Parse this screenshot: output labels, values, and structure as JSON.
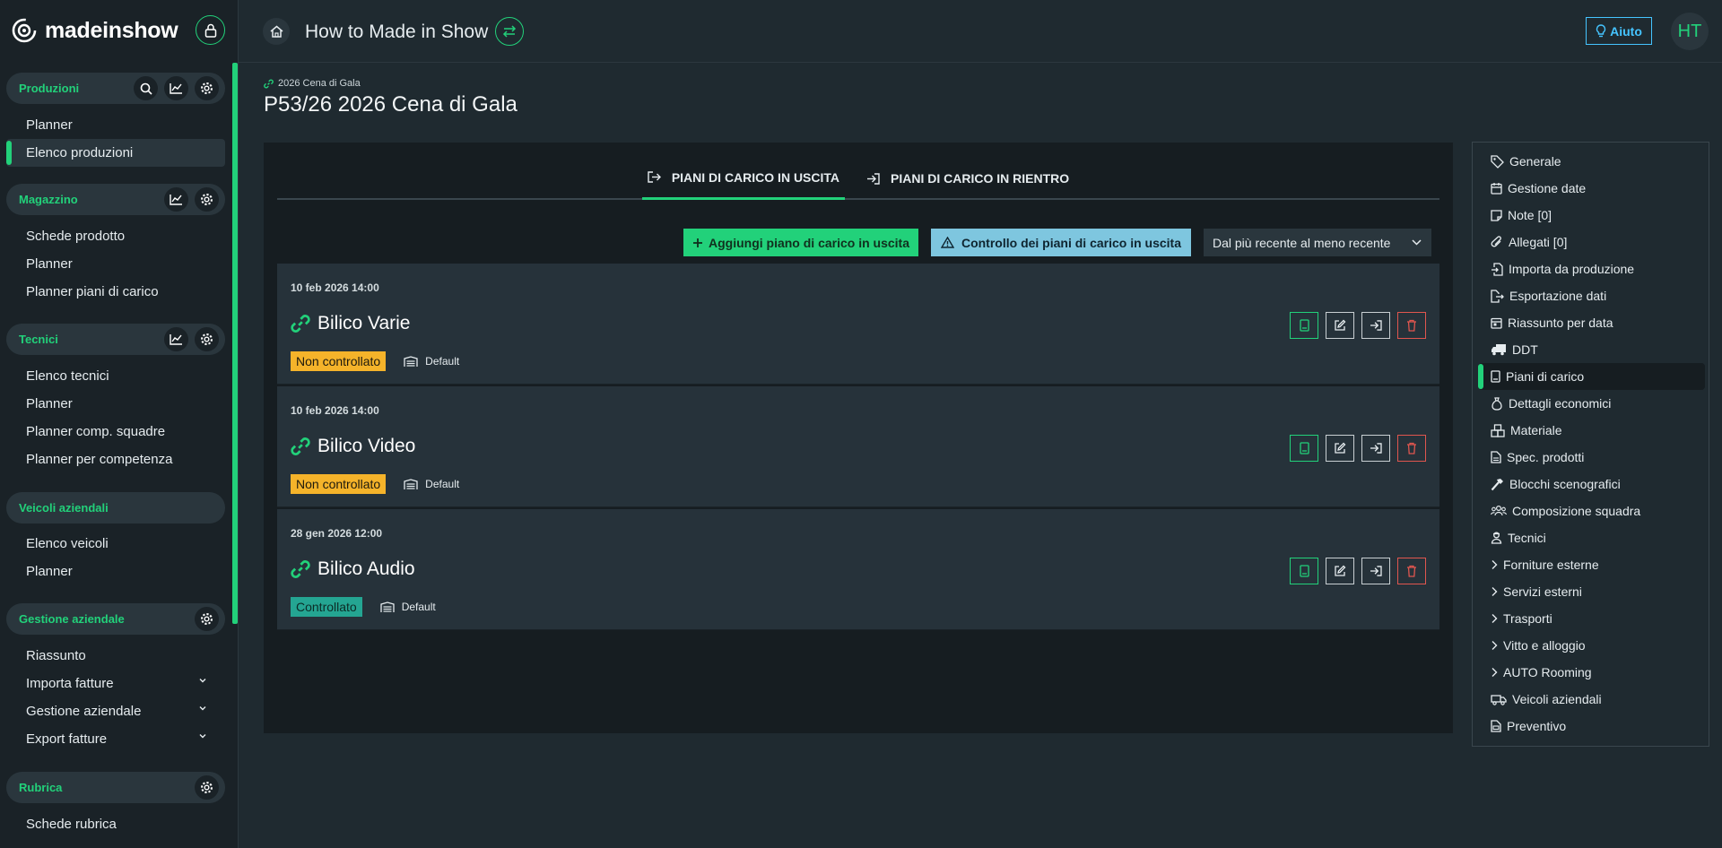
{
  "brand": {
    "name": "madeinshow"
  },
  "sidebar": {
    "sections": [
      {
        "title": "Produzioni",
        "icons": [
          "search-icon",
          "chart-icon",
          "gear-icon"
        ],
        "items": [
          {
            "label": "Planner"
          },
          {
            "label": "Elenco produzioni",
            "active": true
          }
        ]
      },
      {
        "title": "Magazzino",
        "icons": [
          "chart-icon",
          "gear-icon"
        ],
        "items": [
          {
            "label": "Schede prodotto"
          },
          {
            "label": "Planner"
          },
          {
            "label": "Planner piani di carico"
          }
        ]
      },
      {
        "title": "Tecnici",
        "icons": [
          "chart-icon",
          "gear-icon"
        ],
        "items": [
          {
            "label": "Elenco tecnici"
          },
          {
            "label": "Planner"
          },
          {
            "label": "Planner comp. squadre"
          },
          {
            "label": "Planner per competenza"
          }
        ]
      },
      {
        "title": "Veicoli aziendali",
        "icons": [],
        "items": [
          {
            "label": "Elenco veicoli"
          },
          {
            "label": "Planner"
          }
        ]
      },
      {
        "title": "Gestione aziendale",
        "icons": [
          "gear-icon"
        ],
        "items": [
          {
            "label": "Riassunto"
          },
          {
            "label": "Importa fatture",
            "expandable": true
          },
          {
            "label": "Gestione aziendale",
            "expandable": true
          },
          {
            "label": "Export fatture",
            "expandable": true
          }
        ]
      },
      {
        "title": "Rubrica",
        "icons": [
          "gear-icon"
        ],
        "items": [
          {
            "label": "Schede rubrica"
          }
        ]
      }
    ]
  },
  "header": {
    "title": "How to Made in Show",
    "help_label": "Aiuto",
    "avatar_initials": "HT"
  },
  "breadcrumb": {
    "label": "2026 Cena di Gala"
  },
  "page": {
    "title": "P53/26 2026 Cena di Gala"
  },
  "tabs": [
    {
      "label": "PIANI DI CARICO IN USCITA",
      "active": true
    },
    {
      "label": "PIANI DI CARICO IN RIENTRO",
      "active": false
    }
  ],
  "toolbar": {
    "add_label": "Aggiungi piano di carico in uscita",
    "check_label": "Controllo dei piani di carico in uscita",
    "sort_value": "Dal più recente al meno recente"
  },
  "plans": [
    {
      "date": "10 feb 2026 14:00",
      "name": "Bilico Varie",
      "status": "Non controllato",
      "status_kind": "warn",
      "vehicle": "Default"
    },
    {
      "date": "10 feb 2026 14:00",
      "name": "Bilico Video",
      "status": "Non controllato",
      "status_kind": "warn",
      "vehicle": "Default"
    },
    {
      "date": "28 gen 2026 12:00",
      "name": "Bilico Audio",
      "status": "Controllato",
      "status_kind": "ok",
      "vehicle": "Default"
    }
  ],
  "right_menu": [
    {
      "label": "Generale",
      "icon": "tag-icon"
    },
    {
      "label": "Gestione date",
      "icon": "calendar-icon"
    },
    {
      "label": "Note [0]",
      "icon": "note-icon"
    },
    {
      "label": "Allegati [0]",
      "icon": "paperclip-icon"
    },
    {
      "label": "Importa da produzione",
      "icon": "file-import-icon"
    },
    {
      "label": "Esportazione dati",
      "icon": "file-export-icon"
    },
    {
      "label": "Riassunto per data",
      "icon": "calendar-day-icon"
    },
    {
      "label": "DDT",
      "icon": "truck-icon"
    },
    {
      "label": "Piani di carico",
      "icon": "clipboard-icon",
      "active": true
    },
    {
      "label": "Dettagli economici",
      "icon": "money-bag-icon"
    },
    {
      "label": "Materiale",
      "icon": "boxes-icon"
    },
    {
      "label": "Spec. prodotti",
      "icon": "file-icon"
    },
    {
      "label": "Blocchi scenografici",
      "icon": "hammer-icon"
    },
    {
      "label": "Composizione squadra",
      "icon": "team-icon"
    },
    {
      "label": "Tecnici",
      "icon": "person-icon"
    },
    {
      "label": "Forniture esterne",
      "icon": "chevron-right-icon"
    },
    {
      "label": "Servizi esterni",
      "icon": "chevron-right-icon"
    },
    {
      "label": "Trasporti",
      "icon": "chevron-right-icon"
    },
    {
      "label": "Vitto e alloggio",
      "icon": "chevron-right-icon"
    },
    {
      "label": "AUTO Rooming",
      "icon": "chevron-right-icon"
    },
    {
      "label": "Veicoli aziendali",
      "icon": "van-icon"
    },
    {
      "label": "Preventivo",
      "icon": "file-invoice-icon"
    }
  ]
}
